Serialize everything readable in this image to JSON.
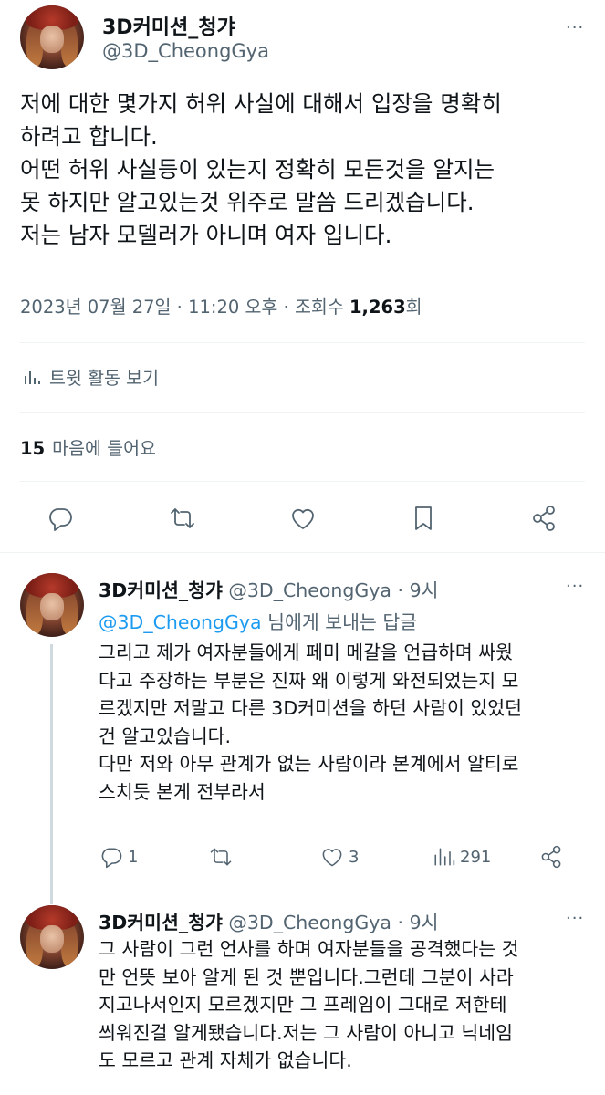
{
  "main_tweet": {
    "author_name": "3D커미션_청갸",
    "author_handle": "@3D_CheongGya",
    "more_glyph": "···",
    "text_lines": [
      "저에 대한 몇가지 허위 사실에 대해서 입장을 명확히",
      "하려고 합니다.",
      "어떤 허위 사실등이 있는지 정확히 모든것을 알지는",
      "못 하지만 알고있는것 위주로 말씀 드리겠습니다.",
      "저는 남자 모델러가 아니며 여자 입니다."
    ],
    "timestamp": "2023년 07월 27일 · 11:20 오후",
    "views_label_prefix": " · 조회수 ",
    "views_count": "1,263",
    "views_label_suffix": "회",
    "activity_label": "트윗 활동 보기",
    "likes_count": "15",
    "likes_label": "마음에 들어요"
  },
  "replies": [
    {
      "author_name": "3D커미션_청갸",
      "author_handle": "@3D_CheongGya",
      "time": "· 9시",
      "reply_to_mention": "@3D_CheongGya",
      "reply_to_suffix": " 님에게 보내는 답글",
      "text_lines": [
        "그리고 제가 여자분들에게 페미 메갈을 언급하며 싸웠",
        "다고 주장하는 부분은 진짜 왜 이렇게 와전되었는지 모",
        "르겠지만 저말고 다른 3D커미션을 하던 사람이 있었던",
        "건 알고있습니다.",
        "다만 저와 아무 관계가 없는 사람이라 본계에서 알티로",
        "스치듯 본게 전부라서"
      ],
      "reply_count": "1",
      "retweet_count": "",
      "like_count": "3",
      "view_count": "291"
    },
    {
      "author_name": "3D커미션_청갸",
      "author_handle": "@3D_CheongGya",
      "time": "· 9시",
      "text_lines": [
        "그 사람이 그런 언사를 하며 여자분들을 공격했다는 것",
        "만 언뜻 보아 알게 된 것 뿐입니다.그런데 그분이 사라",
        "지고나서인지 모르겠지만 그 프레임이 그대로 저한테",
        "씌워진걸 알게됐습니다.저는 그 사람이 아니고 닉네임",
        "도 모르고 관계 자체가 없습니다."
      ]
    }
  ],
  "icons": {
    "reply": "speech-bubble",
    "retweet": "retweet-arrows",
    "like": "heart",
    "bookmark": "bookmark",
    "share": "share-nodes",
    "views": "bar-chart"
  },
  "colors": {
    "text": "#0f1419",
    "secondary": "#536471",
    "link": "#1d9bf0",
    "divider": "#eff3f4",
    "thread_line": "#cfd9de"
  }
}
